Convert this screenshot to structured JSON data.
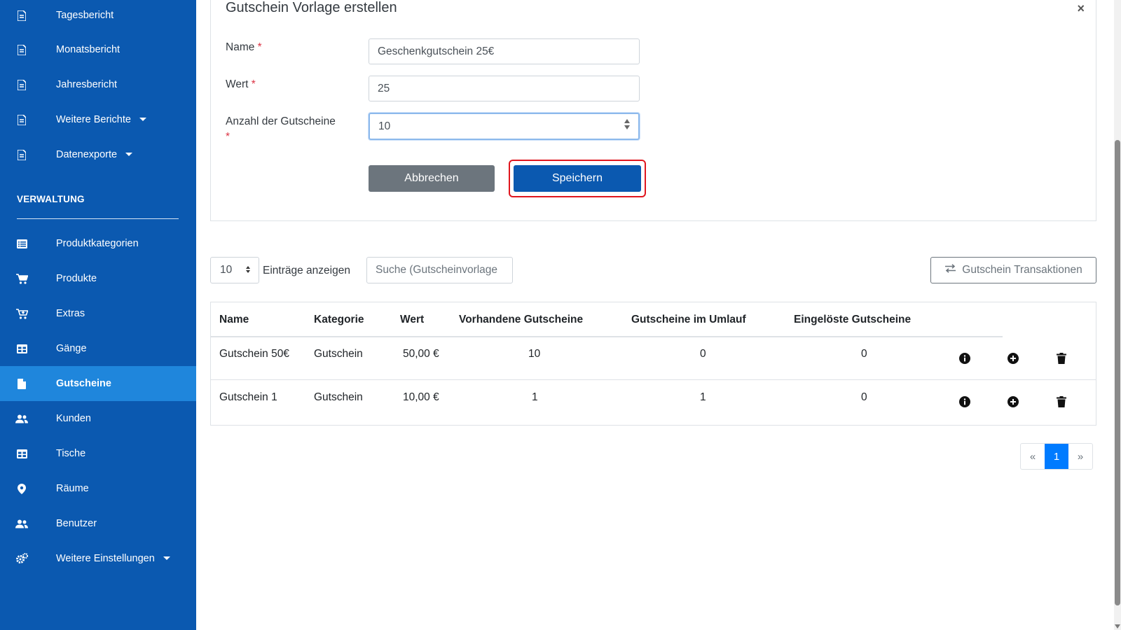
{
  "sidebar": {
    "items_top": [
      {
        "label": "Tagesbericht",
        "icon": "document-icon"
      },
      {
        "label": "Monatsbericht",
        "icon": "document-icon"
      },
      {
        "label": "Jahresbericht",
        "icon": "document-icon"
      },
      {
        "label": "Weitere Berichte",
        "icon": "document-icon",
        "has_caret": true
      },
      {
        "label": "Datenexporte",
        "icon": "document-icon",
        "has_caret": true
      }
    ],
    "section_title": "VERWALTUNG",
    "items": [
      {
        "label": "Produktkategorien",
        "icon": "list-icon"
      },
      {
        "label": "Produkte",
        "icon": "cart-icon"
      },
      {
        "label": "Extras",
        "icon": "cart-plus-icon"
      },
      {
        "label": "Gänge",
        "icon": "table-icon"
      },
      {
        "label": "Gutscheine",
        "icon": "file-icon",
        "active": true
      },
      {
        "label": "Kunden",
        "icon": "users-icon"
      },
      {
        "label": "Tische",
        "icon": "table-icon"
      },
      {
        "label": "Räume",
        "icon": "map-marker-icon"
      },
      {
        "label": "Benutzer",
        "icon": "users-icon"
      },
      {
        "label": "Weitere Einstellungen",
        "icon": "cogs-icon",
        "has_caret": true
      }
    ],
    "colors": {
      "background": "#0b59b0",
      "active": "#1f86dc"
    }
  },
  "form": {
    "title": "Gutschein Vorlage erstellen",
    "close_symbol": "×",
    "name_label": "Name",
    "name_value": "Geschenkgutschein 25€",
    "wert_label": "Wert",
    "wert_value": "25",
    "anzahl_label": "Anzahl der Gutscheine",
    "anzahl_value": "10",
    "required_mark": "*",
    "cancel_label": "Abbrechen",
    "save_label": "Speichern"
  },
  "toolbar": {
    "page_length": "10",
    "length_label": "Einträge anzeigen",
    "search_placeholder": "Suche (Gutscheinvorlage",
    "transactions_label": "Gutschein Transaktionen"
  },
  "table": {
    "headers": [
      "Name",
      "Kategorie",
      "Wert",
      "Vorhandene Gutscheine",
      "Gutscheine im Umlauf",
      "Eingelöste Gutscheine"
    ],
    "rows": [
      [
        "Gutschein 50€",
        "Gutschein",
        "50,00 €",
        "10",
        "0",
        "0"
      ],
      [
        "Gutschein 1",
        "Gutschein",
        "10,00 €",
        "1",
        "1",
        "0"
      ]
    ]
  },
  "pagination": {
    "prev": "«",
    "current": "1",
    "next": "»"
  }
}
